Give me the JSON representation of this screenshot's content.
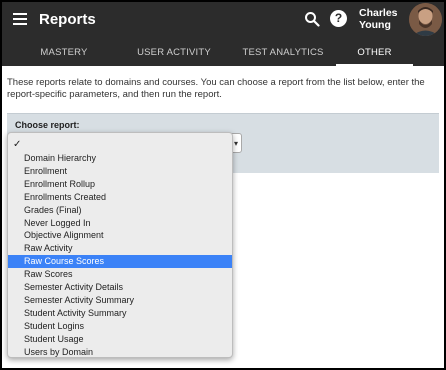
{
  "header": {
    "title": "Reports",
    "user_first": "Charles",
    "user_last": "Young",
    "help_label": "?"
  },
  "tabs": [
    {
      "label": "MASTERY",
      "active": false
    },
    {
      "label": "USER ACTIVITY",
      "active": false
    },
    {
      "label": "TEST ANALYTICS",
      "active": false
    },
    {
      "label": "OTHER",
      "active": true
    }
  ],
  "nav": {
    "prev_label": "‹",
    "next_label": "›"
  },
  "intro_text": "These reports relate to domains and courses. You can choose a report from the list below, enter the report-specific parameters, and then run the report.",
  "choose_report": {
    "label": "Choose report:",
    "selected_value": "",
    "caret": "▾"
  },
  "dropdown": {
    "check_glyph": "✓",
    "selected_index": 8,
    "options": [
      "Domain Hierarchy",
      "Enrollment",
      "Enrollment Rollup",
      "Enrollments Created",
      "Grades (Final)",
      "Never Logged In",
      "Objective Alignment",
      "Raw Activity",
      "Raw Course Scores",
      "Raw Scores",
      "Semester Activity Details",
      "Semester Activity Summary",
      "Student Activity Summary",
      "Student Logins",
      "Student Usage",
      "Users by Domain"
    ]
  },
  "colors": {
    "header_bg": "#2c2c2c",
    "panel_bg": "#d7dee3",
    "highlight": "#3b82f7"
  }
}
